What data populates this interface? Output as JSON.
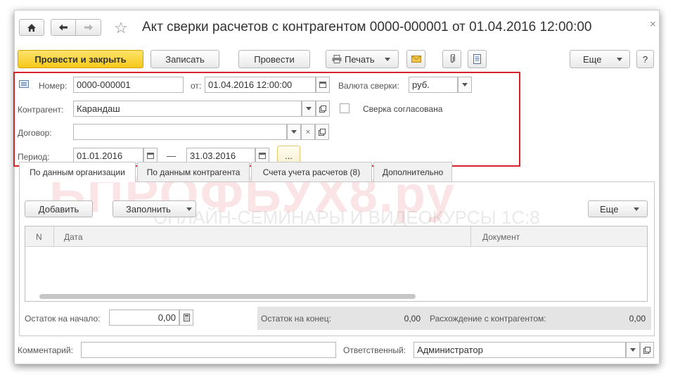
{
  "title": "Акт сверки расчетов с контрагентом 0000-000001 от 01.04.2016 12:00:00",
  "toolbar": {
    "post_close": "Провести и закрыть",
    "save": "Записать",
    "post": "Провести",
    "print": "Печать",
    "more": "Еще",
    "help": "?"
  },
  "header": {
    "number_label": "Номер:",
    "number_value": "0000-000001",
    "date_label": "от:",
    "date_value": "01.04.2016 12:00:00",
    "currency_label": "Валюта сверки:",
    "currency_value": "руб.",
    "counterparty_label": "Контрагент:",
    "counterparty_value": "Карандаш",
    "agreed_label": "Сверка согласована",
    "contract_label": "Договор:",
    "contract_value": "",
    "period_label": "Период:",
    "period_from": "01.01.2016",
    "period_dash": "—",
    "period_to": "31.03.2016",
    "period_select": "..."
  },
  "tabs": [
    {
      "label": "По данным организации"
    },
    {
      "label": "По данным контрагента"
    },
    {
      "label": "Счета учета расчетов (8)"
    },
    {
      "label": "Дополнительно"
    }
  ],
  "table_toolbar": {
    "add": "Добавить",
    "fill": "Заполнить",
    "more": "Еще"
  },
  "table": {
    "columns": [
      "N",
      "Дата",
      "Документ"
    ]
  },
  "totals": {
    "start_label": "Остаток на начало:",
    "start_value": "0,00",
    "end_label": "Остаток на конец:",
    "end_value": "0,00",
    "diff_label": "Расхождение с контрагентом:",
    "diff_value": "0,00"
  },
  "footer": {
    "comment_label": "Комментарий:",
    "comment_value": "",
    "responsible_label": "Ответственный:",
    "responsible_value": "Администратор"
  },
  "watermark": {
    "main": "БПРОФБУХ8.ру",
    "sub": "ОНЛАЙН-СЕМИНАРЫ И ВИДЕОКУРСЫ 1С:8"
  },
  "colors": {
    "primary_button": "#f6c91a",
    "highlight_frame": "#d8222b",
    "watermark": "#d62c36"
  }
}
